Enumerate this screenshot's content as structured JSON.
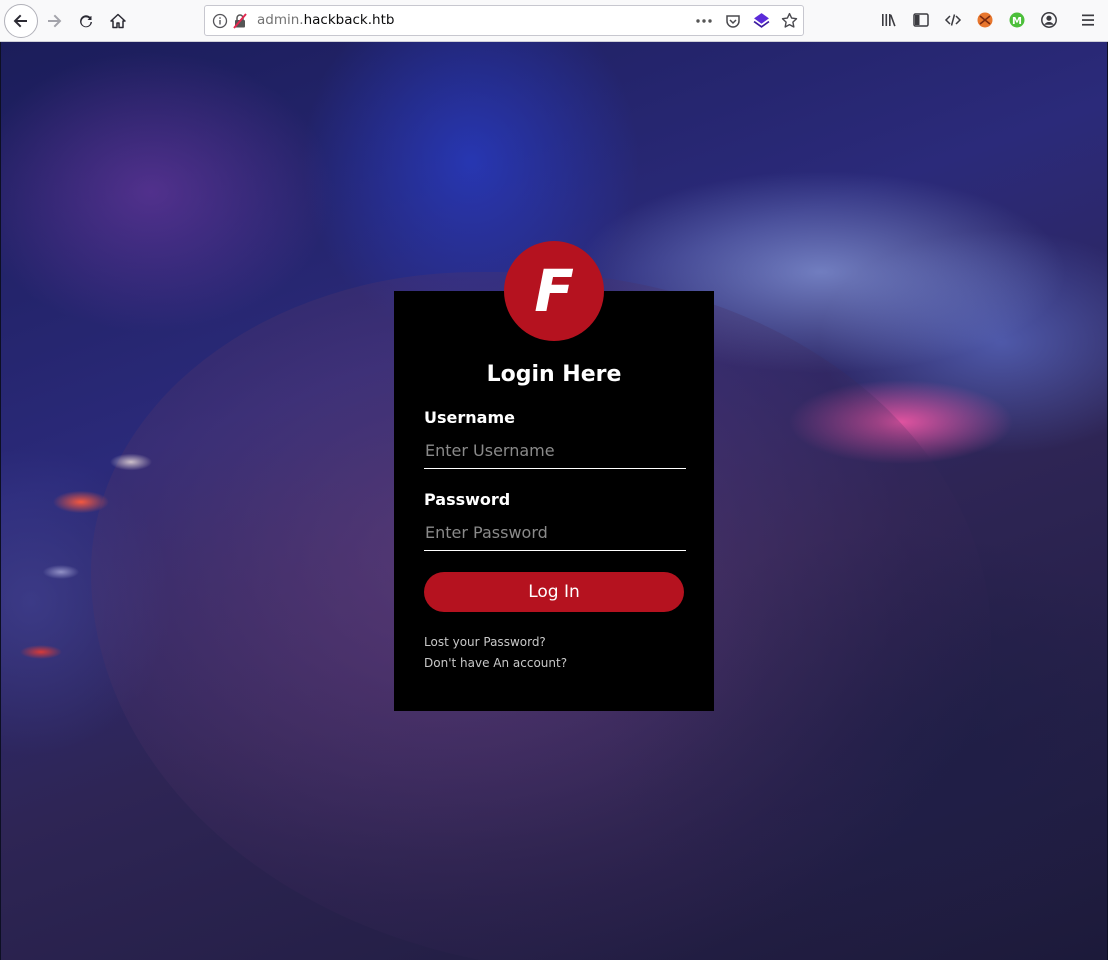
{
  "browser": {
    "url_prefix": "admin.",
    "url_host": "hackback.htb"
  },
  "toolbar_icons": [
    "back-icon",
    "forward-icon",
    "reload-icon",
    "home-icon",
    "info-icon",
    "insecure-connection-icon",
    "page-actions-icon",
    "pocket-icon",
    "extension-icon",
    "bookmark-star-icon",
    "library-icon",
    "sidebar-icon",
    "devtools-icon",
    "addon-icon",
    "addon-icon",
    "account-icon",
    "menu-icon"
  ],
  "colors": {
    "accent_red": "#b5121f",
    "card_background": "#000000",
    "toolbar_background": "#f9f9fa"
  },
  "login": {
    "logo_letter": "F",
    "title": "Login Here",
    "username_label": "Username",
    "username_placeholder": "Enter Username",
    "username_value": "",
    "password_label": "Password",
    "password_placeholder": "Enter Password",
    "password_value": "",
    "submit_label": "Log In",
    "lost_password_link": "Lost your Password?",
    "signup_link": "Don't have An account?"
  }
}
